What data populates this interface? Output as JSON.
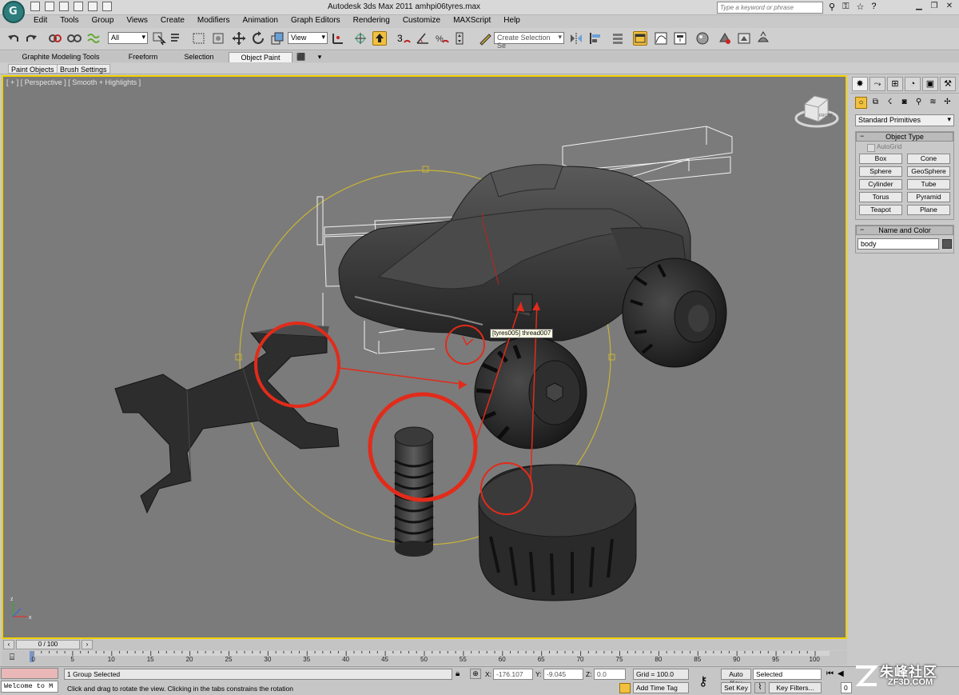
{
  "app": {
    "logo_letter": "G",
    "title": "Autodesk 3ds Max  2011      amhpi06tyres.max",
    "search_placeholder": "Type a keyword or phrase"
  },
  "menu": [
    "Edit",
    "Tools",
    "Group",
    "Views",
    "Create",
    "Modifiers",
    "Animation",
    "Graph Editors",
    "Rendering",
    "Customize",
    "MAXScript",
    "Help"
  ],
  "toolbar": {
    "filter_select": "All",
    "coord_select": "View",
    "selection_set": "Create Selection Se"
  },
  "ribbon": {
    "tabs": [
      "Graphite Modeling Tools",
      "Freeform",
      "Selection",
      "Object Paint"
    ],
    "active_tab": "Object Paint",
    "sub_tabs": [
      "Paint Objects",
      "Brush Settings"
    ]
  },
  "viewport": {
    "label": "[ + ] [ Perspective ] [ Smooth + Highlights ]",
    "tooltip": "[tyres005] thread007",
    "viewcube_label": "FRONT"
  },
  "command_panel": {
    "category": "Standard Primitives",
    "object_type_title": "Object Type",
    "autogrid": "AutoGrid",
    "primitives": [
      "Box",
      "Cone",
      "Sphere",
      "GeoSphere",
      "Cylinder",
      "Tube",
      "Torus",
      "Pyramid",
      "Teapot",
      "Plane"
    ],
    "name_color_title": "Name and Color",
    "object_name": "body"
  },
  "timeline": {
    "frame_display": "0 / 100",
    "ticks": [
      "0",
      "5",
      "10",
      "15",
      "20",
      "25",
      "30",
      "35",
      "40",
      "45",
      "50",
      "55",
      "60",
      "65",
      "70",
      "75",
      "80",
      "85",
      "90",
      "95",
      "100"
    ]
  },
  "status": {
    "maxscript_listener": "Welcome to M",
    "selection_status": "1 Group Selected",
    "prompt": "Click and drag to rotate the view.  Clicking in the tabs constrains the rotation",
    "x_label": "X:",
    "x_value": "-176.107",
    "y_label": "Y:",
    "y_value": "-9.045",
    "z_label": "Z:",
    "z_value": "0.0",
    "grid": "Grid = 100.0",
    "add_time_tag": "Add Time Tag",
    "auto_key": "Auto Key",
    "set_key": "Set Key",
    "key_mode": "Selected",
    "key_filters": "Key Filters...",
    "current_frame": "0"
  },
  "watermark": {
    "title": "朱峰社区",
    "subtitle": "ZF3D.COM"
  },
  "colors": {
    "viewport_bg": "#7b7b7b",
    "viewport_border": "#f0d000",
    "annotation_red": "#e22b1a",
    "gizmo_yellow": "#c8b436"
  }
}
